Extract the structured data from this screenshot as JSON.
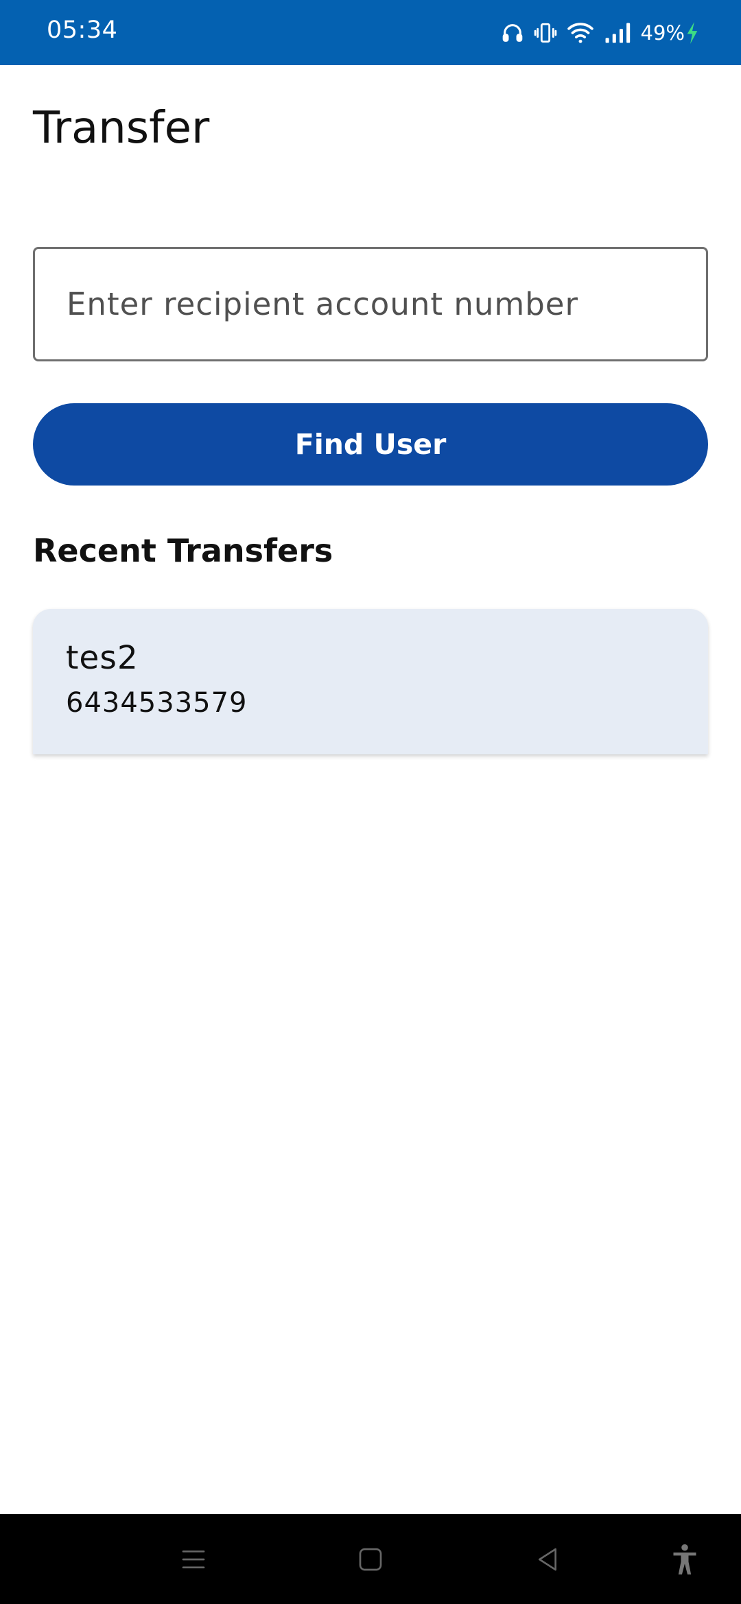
{
  "status_bar": {
    "time": "05:34",
    "battery": "49%",
    "icons": [
      "headset-icon",
      "vibrate-icon",
      "wifi-icon",
      "signal-icon",
      "battery-charging-icon"
    ]
  },
  "page": {
    "title": "Transfer"
  },
  "search": {
    "placeholder": "Enter recipient account number",
    "value": ""
  },
  "actions": {
    "find_user_label": "Find User"
  },
  "recent": {
    "header": "Recent Transfers",
    "items": [
      {
        "name": "tes2",
        "account": "6434533579"
      }
    ]
  },
  "nav": {
    "icons": [
      "menu-icon",
      "home-icon",
      "back-icon",
      "accessibility-icon"
    ]
  },
  "colors": {
    "status_bar": "#0461b1",
    "primary_button": "#0e4aa3",
    "card_background": "#e6ecf5",
    "charging_bolt": "#3ddc84"
  }
}
